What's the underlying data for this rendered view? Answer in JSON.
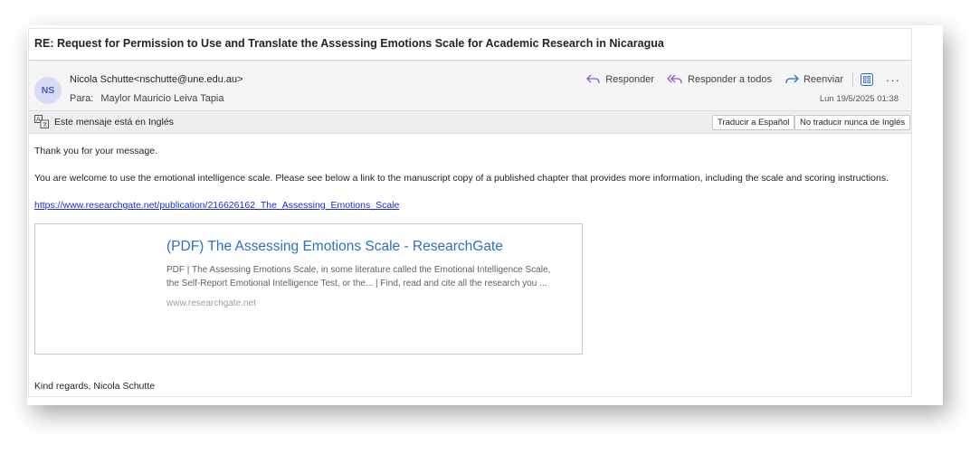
{
  "email": {
    "subject": "RE: Request for Permission to Use and Translate the Assessing Emotions Scale for Academic Research in Nicaragua",
    "avatar_initials": "NS",
    "sender": "Nicola Schutte<nschutte@une.edu.au>",
    "to_label": "Para:",
    "to_name": "Maylor Mauricio Leiva Tapia",
    "date": "Lun 19/5/2025 01:38"
  },
  "actions": {
    "reply": "Responder",
    "reply_all": "Responder a todos",
    "forward": "Reenviar",
    "more": "···"
  },
  "translation": {
    "message": "Este mensaje está en Inglés",
    "translate_button": "Traducir a Español",
    "never_translate_button": "No traducir nunca de Inglés"
  },
  "body": {
    "greeting": "Thank you for your message.",
    "paragraph": "You are welcome to use the emotional intelligence scale. Please  see below a link to the manuscript copy of a published chapter that provides more information, including the scale and scoring instructions.",
    "link": "https://www.researchgate.net/publication/216626162_The_Assessing_Emotions_Scale",
    "signoff": "Kind regards, Nicola Schutte"
  },
  "preview_card": {
    "title": "(PDF) The Assessing Emotions Scale - ResearchGate",
    "description": "PDF | The Assessing Emotions Scale, in some literature called the Emotional Intelligence Scale, the Self-Report Emotional Intelligence Test, or the... | Find, read and cite all the research you ...",
    "domain": "www.researchgate.net"
  },
  "colors": {
    "accent_purple": "#8a5bd1",
    "accent_blue": "#2f6fc4",
    "link_blue": "#1a2fd1"
  }
}
